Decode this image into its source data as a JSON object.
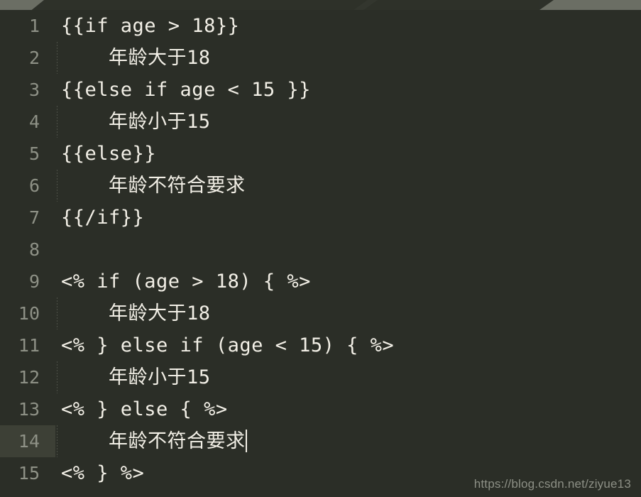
{
  "window": {
    "theme_background": "#2b2e27",
    "gutter_text_color": "#8e9186",
    "code_text_color": "#f2efe6",
    "current_line_highlight": "#3d4036",
    "tab_inactive_color": "#6b6e64",
    "tab_active_color": "#2e3129"
  },
  "editor": {
    "current_line": 14,
    "lines": [
      {
        "number": "1",
        "text": "{{if age > 18}}",
        "indent": false
      },
      {
        "number": "2",
        "text": "    年龄大于18",
        "indent": true
      },
      {
        "number": "3",
        "text": "{{else if age < 15 }}",
        "indent": false
      },
      {
        "number": "4",
        "text": "    年龄小于15",
        "indent": true
      },
      {
        "number": "5",
        "text": "{{else}}",
        "indent": false
      },
      {
        "number": "6",
        "text": "    年龄不符合要求",
        "indent": true
      },
      {
        "number": "7",
        "text": "{{/if}}",
        "indent": false
      },
      {
        "number": "8",
        "text": "",
        "indent": false
      },
      {
        "number": "9",
        "text": "<% if (age > 18) { %>",
        "indent": false
      },
      {
        "number": "10",
        "text": "    年龄大于18",
        "indent": true
      },
      {
        "number": "11",
        "text": "<% } else if (age < 15) { %>",
        "indent": false
      },
      {
        "number": "12",
        "text": "    年龄小于15",
        "indent": true
      },
      {
        "number": "13",
        "text": "<% } else { %>",
        "indent": false
      },
      {
        "number": "14",
        "text": "    年龄不符合要求",
        "indent": false
      },
      {
        "number": "15",
        "text": "<% } %>",
        "indent": false
      }
    ]
  },
  "watermark": {
    "text": "https://blog.csdn.net/ziyue13"
  }
}
